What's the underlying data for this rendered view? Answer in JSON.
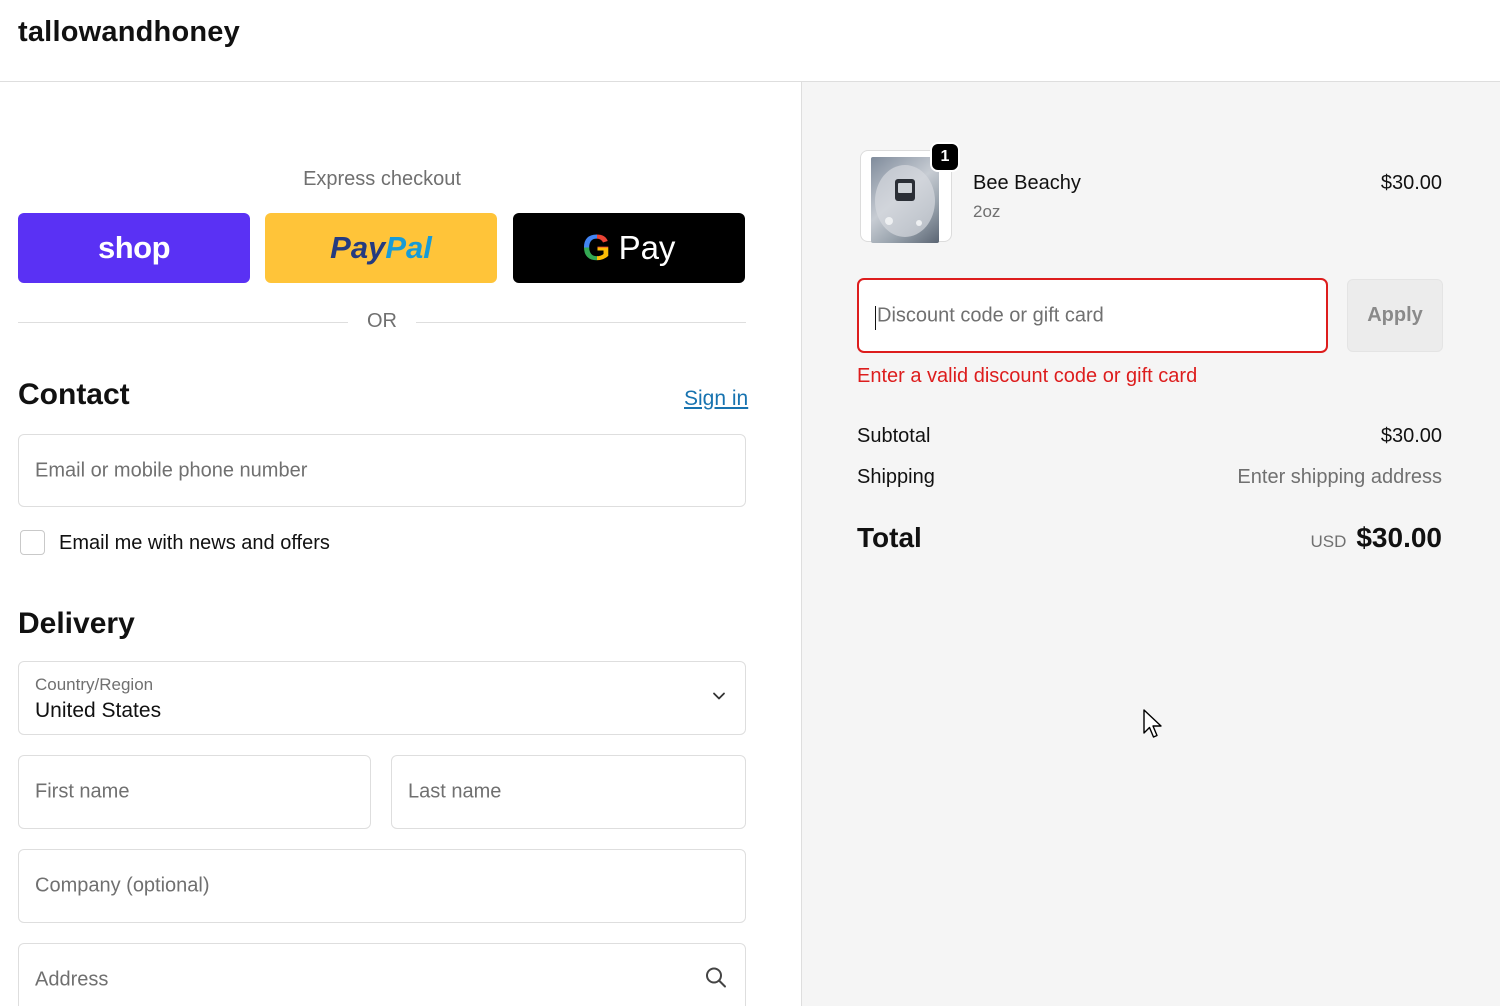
{
  "header": {
    "brand": "tallowandhoney"
  },
  "express": {
    "label": "Express checkout",
    "shop_label": "shop",
    "paypal_part1": "Pay",
    "paypal_part2": "Pal",
    "gpay_g": "G",
    "gpay_label": "Pay",
    "or_label": "OR"
  },
  "contact": {
    "heading": "Contact",
    "signin": "Sign in",
    "email_placeholder": "Email or mobile phone number",
    "newsletter_label": "Email me with news and offers"
  },
  "delivery": {
    "heading": "Delivery",
    "country_label": "Country/Region",
    "country_value": "United States",
    "first_name_placeholder": "First name",
    "last_name_placeholder": "Last name",
    "company_placeholder": "Company (optional)",
    "address_placeholder": "Address"
  },
  "order": {
    "item": {
      "name": "Bee Beachy",
      "variant": "2oz",
      "price": "$30.00",
      "quantity": "1"
    },
    "discount_placeholder": "Discount code or gift card",
    "apply_label": "Apply",
    "discount_error": "Enter a valid discount code or gift card",
    "subtotal_label": "Subtotal",
    "subtotal_value": "$30.00",
    "shipping_label": "Shipping",
    "shipping_value": "Enter shipping address",
    "total_label": "Total",
    "total_currency": "USD",
    "total_value": "$30.00"
  },
  "colors": {
    "shop": "#5a31f4",
    "paypal": "#ffc439",
    "gpay": "#000000",
    "link": "#1773b0",
    "error": "#dd1d1d"
  }
}
